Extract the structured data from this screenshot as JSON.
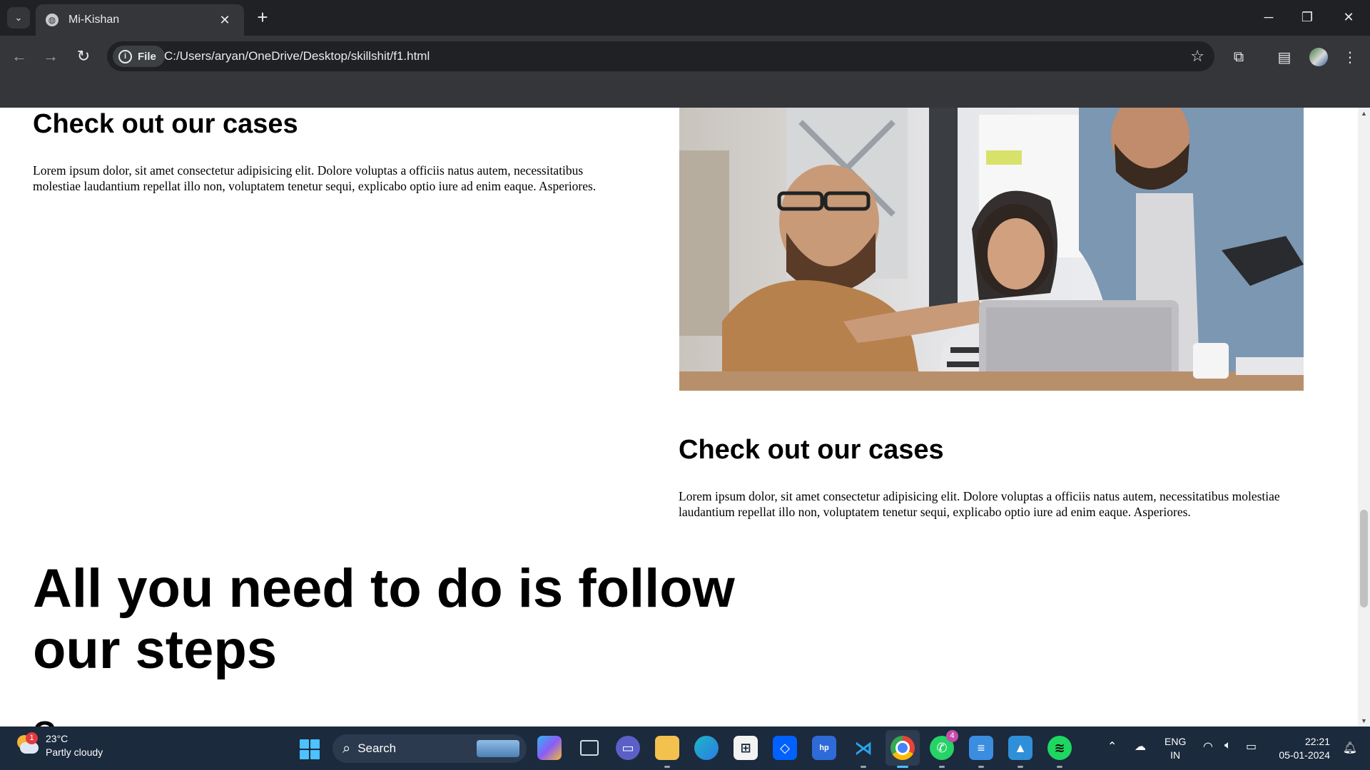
{
  "browser": {
    "tab_title": "Mi-Kishan",
    "tab_close": "✕",
    "new_tab": "+",
    "file_chip": "File",
    "url": "C:/Users/aryan/OneDrive/Desktop/skillshit/f1.html"
  },
  "page": {
    "section1": {
      "heading": "Check out our cases",
      "text": "Lorem ipsum dolor, sit amet consectetur adipisicing elit. Dolore voluptas a officiis natus autem, necessitatibus molestiae laudantium repellat illo non, voluptatem tenetur sequi, explicabo optio iure ad enim eaque. Asperiores."
    },
    "section2": {
      "heading": "Check out our cases",
      "text": "Lorem ipsum dolor, sit amet consectetur adipisicing elit. Dolore voluptas a officiis natus autem, necessitatibus molestiae laudantium repellat illo non, voluptatem tenetur sequi, explicabo optio iure ad enim eaque. Asperiores."
    },
    "big_heading": "All you need to do is follow our steps",
    "cut_heading": "C"
  },
  "taskbar": {
    "weather_temp": "23°C",
    "weather_desc": "Partly cloudy",
    "weather_badge": "1",
    "search_label": "Search",
    "whatsapp_badge": "4",
    "lang_line1": "ENG",
    "lang_line2": "IN",
    "time": "22:21",
    "date": "05-01-2024"
  }
}
